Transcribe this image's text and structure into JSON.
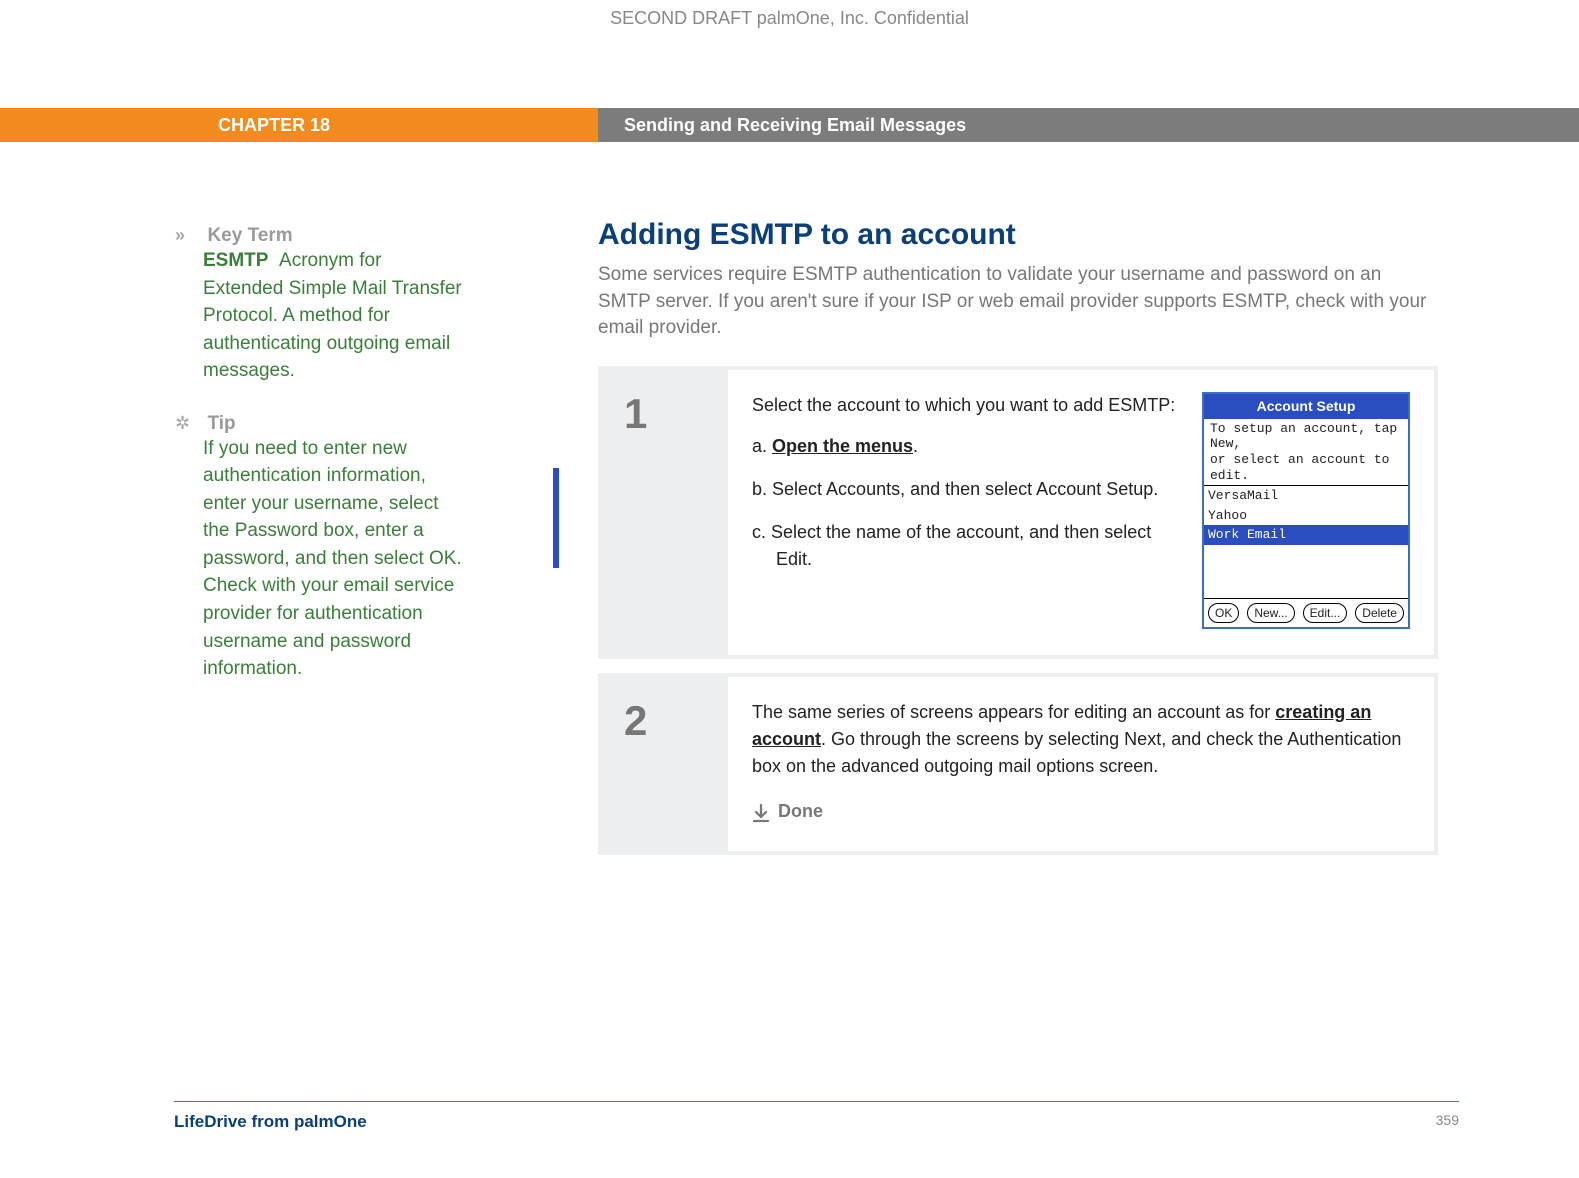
{
  "watermark": "SECOND DRAFT palmOne, Inc.  Confidential",
  "chapter": {
    "label": "CHAPTER 18",
    "title": "Sending and Receiving Email Messages"
  },
  "sidebar": {
    "keyterm": {
      "icon": "»",
      "label": "Key Term",
      "term": "ESMTP",
      "body": "Acronym for Extended Simple Mail Transfer Protocol. A method for authenticating outgoing email messages."
    },
    "tip": {
      "icon": "✲",
      "label": "Tip",
      "body": "If you need to enter new authentication information, enter your username, select the Password box, enter a password, and then select OK. Check with your email service provider for authentication username and password information."
    }
  },
  "main": {
    "title": "Adding ESMTP to an account",
    "intro": "Some services require ESMTP authentication to validate your username and password on an SMTP server. If you aren't sure if your ISP or web email provider supports ESMTP, check with your email provider.",
    "step1": {
      "num": "1",
      "intro": "Select the account to which you want to add ESMTP:",
      "a_prefix": "a.  ",
      "a_link": "Open the menus",
      "a_suffix": ".",
      "b": "b.  Select Accounts, and then select Account Setup.",
      "c": "c.  Select the name of the account, and then select Edit."
    },
    "step2": {
      "num": "2",
      "pre": "The same series of screens appears for editing an account as for ",
      "link": "creating an account",
      "post": ". Go through the screens by selecting Next, and check the Authentication box on the advanced outgoing mail options screen.",
      "done": "Done"
    }
  },
  "device": {
    "title": "Account Setup",
    "hint1": "To setup an account, tap New,",
    "hint2": "or select an account to edit.",
    "items": [
      "VersaMail",
      "Yahoo",
      "Work Email"
    ],
    "selected_index": 2,
    "buttons": [
      "OK",
      "New...",
      "Edit...",
      "Delete"
    ]
  },
  "footer": {
    "product": "LifeDrive from palmOne",
    "page": "359"
  }
}
